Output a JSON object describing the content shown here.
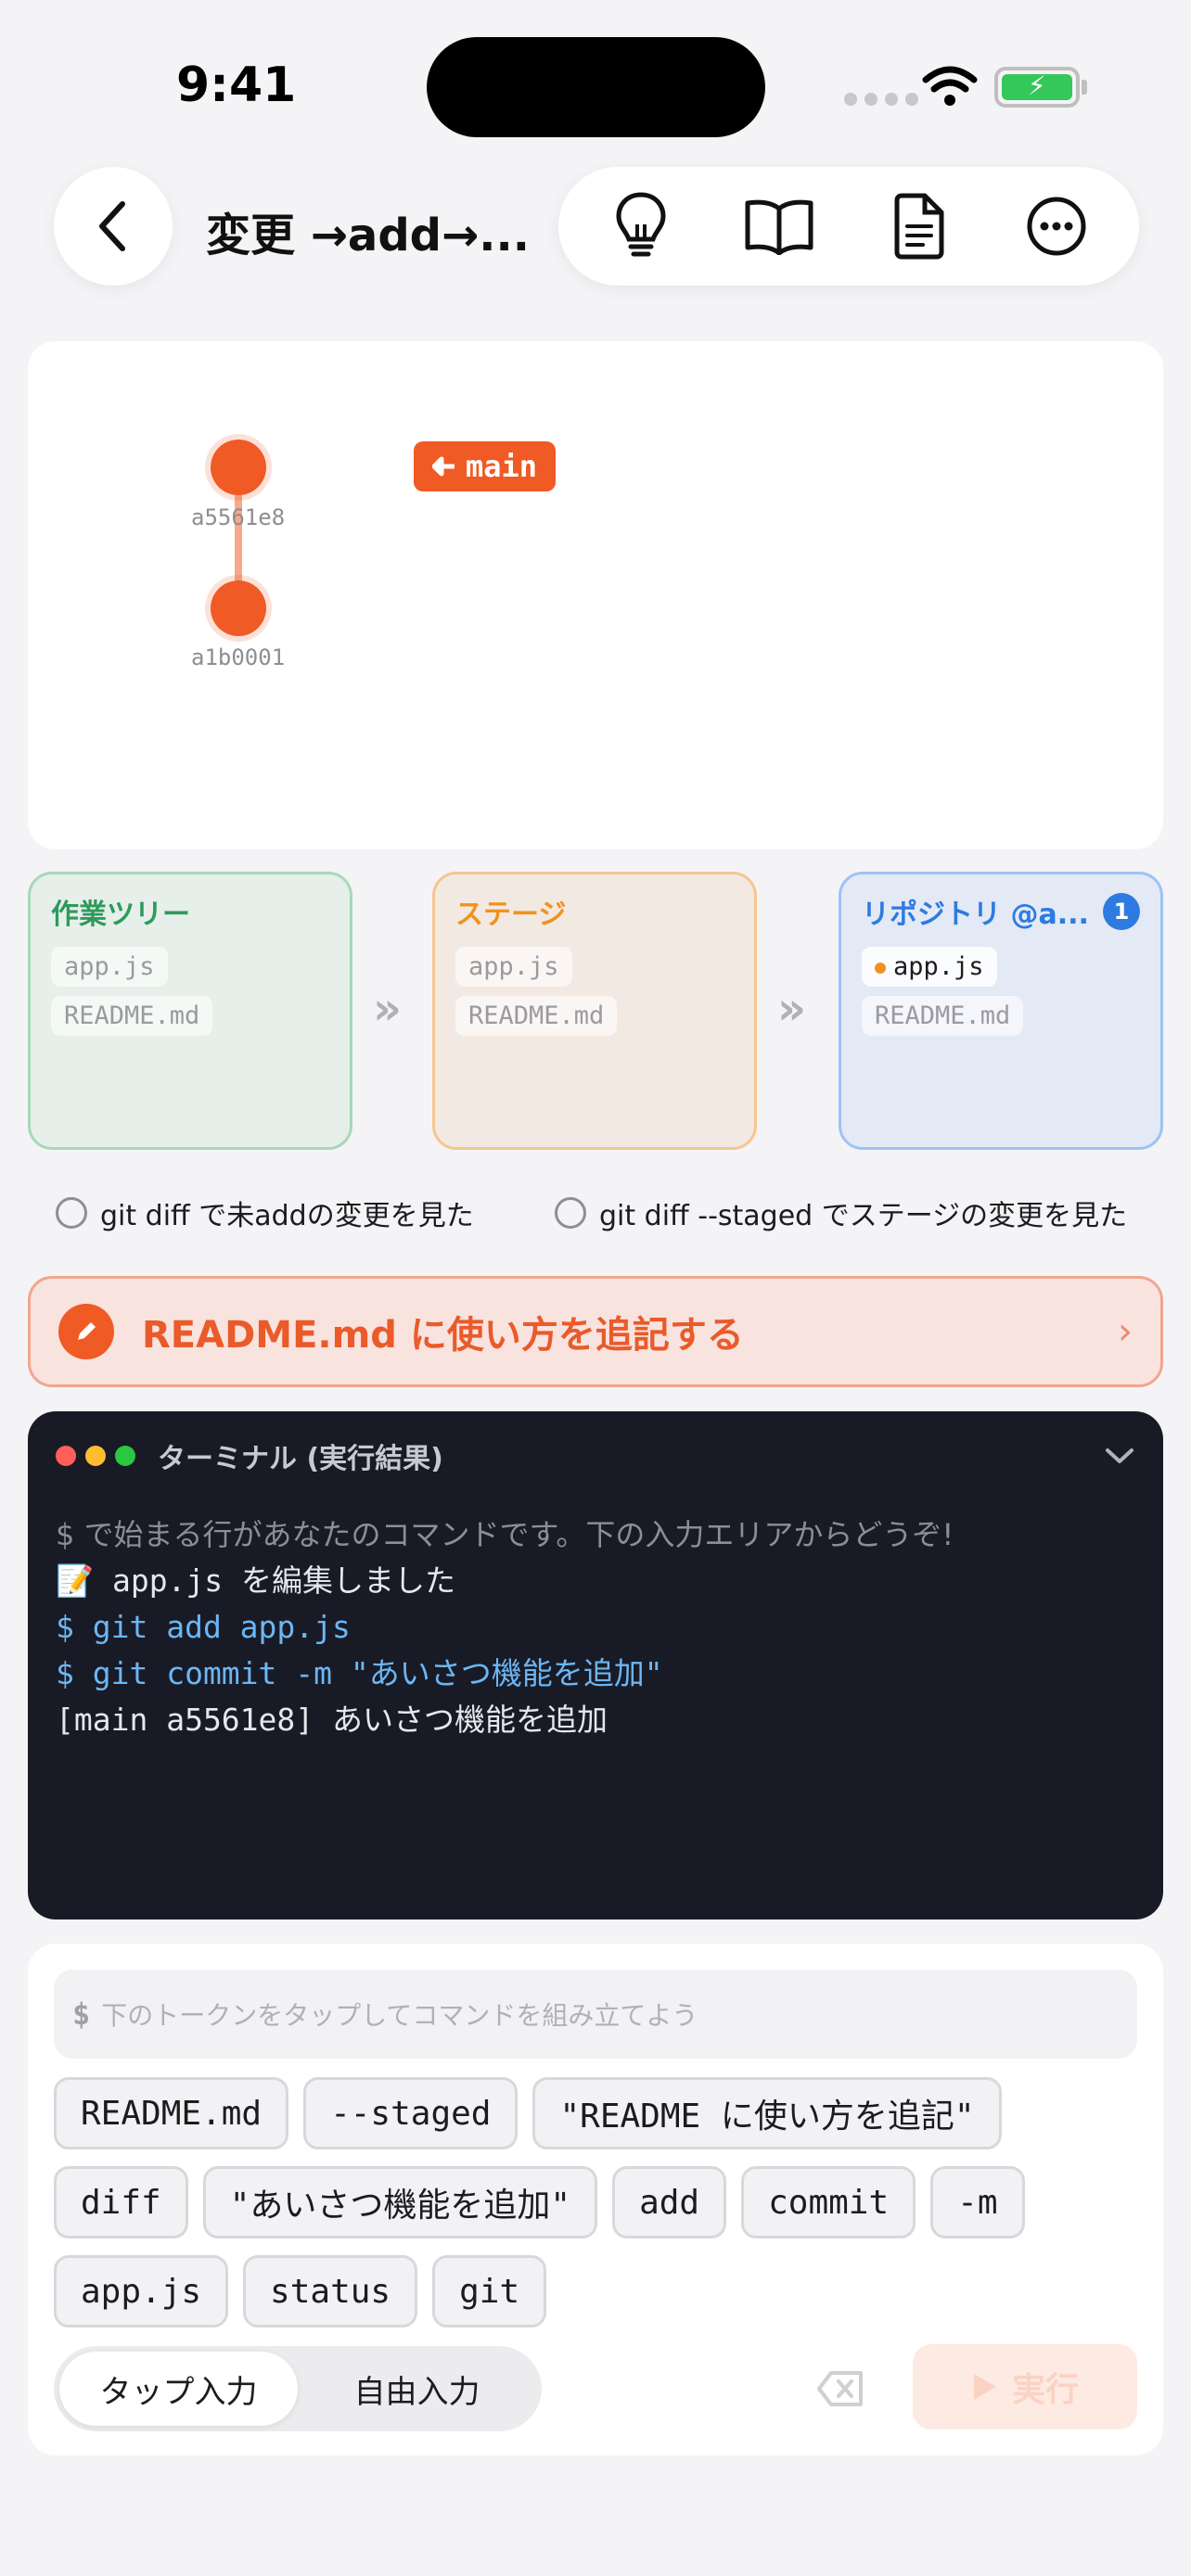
{
  "status_bar": {
    "time": "9:41"
  },
  "header": {
    "title": "変更 →add→...",
    "toolbar": [
      "lightbulb-icon",
      "book-icon",
      "document-icon",
      "more-icon"
    ]
  },
  "graph": {
    "commits": [
      {
        "hash": "a5561e8"
      },
      {
        "hash": "a1b0001"
      }
    ],
    "branch": {
      "name": "main",
      "icon": "arrow-left-icon"
    }
  },
  "areas": {
    "work": {
      "title": "作業ツリー",
      "files": [
        "app.js",
        "README.md"
      ]
    },
    "stage": {
      "title": "ステージ",
      "files": [
        "app.js",
        "README.md"
      ]
    },
    "repo": {
      "title": "リポジトリ @a...",
      "badge": "1",
      "files": [
        "app.js",
        "README.md"
      ],
      "modified_file": "app.js"
    },
    "separator": "»"
  },
  "checklist": [
    {
      "label": "git diff で未addの変更を見た",
      "checked": false
    },
    {
      "label": "git diff --staged でステージの変更を見た",
      "checked": false
    }
  ],
  "task": {
    "label": "README.md に使い方を追記する",
    "icon": "pencil-icon",
    "chevron": "›"
  },
  "terminal": {
    "title": "ターミナル (実行結果)",
    "lines": [
      {
        "kind": "hint",
        "text": "$ で始まる行があなたのコマンドです。下の入力エリアからどうぞ!"
      },
      {
        "kind": "out",
        "text": "📝 app.js を編集しました"
      },
      {
        "kind": "cmd",
        "text": "$ git add app.js"
      },
      {
        "kind": "cmd",
        "text": "$ git commit -m \"あいさつ機能を追加\""
      },
      {
        "kind": "out",
        "text": "[main a5561e8] あいさつ機能を追加"
      }
    ]
  },
  "input": {
    "prompt": "$",
    "placeholder": "下のトークンをタップしてコマンドを組み立てよう",
    "tokens": [
      "README.md",
      "--staged",
      "\"README に使い方を追記\"",
      "diff",
      "\"あいさつ機能を追加\"",
      "add",
      "commit",
      "-m",
      "app.js",
      "status",
      "git"
    ],
    "modes": [
      "タップ入力",
      "自由入力"
    ],
    "active_mode": "タップ入力",
    "run_label": "実行"
  },
  "colors": {
    "accent": "#f05a24",
    "work": "#2d9a5a",
    "stage": "#f0921c",
    "repo": "#2d7be0",
    "terminal_bg": "#181b26",
    "terminal_cmd": "#6cb6f5"
  }
}
